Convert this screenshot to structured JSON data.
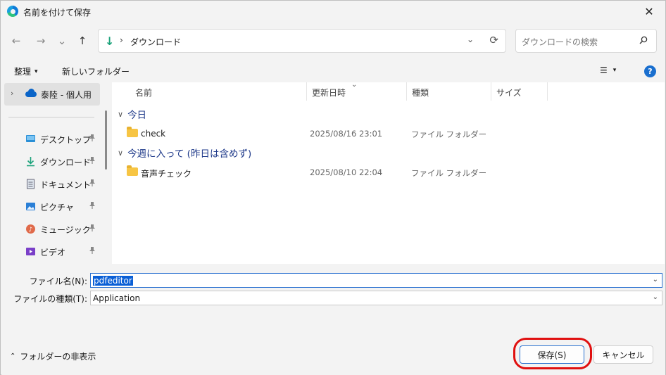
{
  "window": {
    "title": "名前を付けて保存",
    "close_glyph": "✕"
  },
  "nav": {
    "back": "←",
    "forward": "→",
    "recent": "⌄",
    "up": "↑",
    "address": {
      "location": "ダウンロード",
      "chevron": "›",
      "dropdown": "⌄",
      "refresh": "⟳"
    },
    "search": {
      "placeholder": "ダウンロードの検索"
    }
  },
  "toolbar": {
    "organize": "整理",
    "organize_caret": "▾",
    "new_folder": "新しいフォルダー",
    "view_glyph": "☰",
    "view_caret": "▾",
    "help": "?"
  },
  "sidebar": {
    "onedrive": {
      "label": "泰陸 - 個人用",
      "chevron": "›"
    },
    "items": [
      {
        "label": "デスクトップ",
        "icon": "desktop-icon"
      },
      {
        "label": "ダウンロード",
        "icon": "download-icon"
      },
      {
        "label": "ドキュメント",
        "icon": "document-icon"
      },
      {
        "label": "ピクチャ",
        "icon": "pictures-icon"
      },
      {
        "label": "ミュージック",
        "icon": "music-icon"
      },
      {
        "label": "ビデオ",
        "icon": "video-icon"
      }
    ]
  },
  "content": {
    "columns": [
      "名前",
      "更新日時",
      "種類",
      "サイズ"
    ],
    "sort_glyph": "⌄",
    "groups": [
      {
        "label": "今日",
        "chevron": "∨",
        "files": [
          {
            "name": "check",
            "date": "2025/08/16 23:01",
            "type": "ファイル フォルダー"
          }
        ]
      },
      {
        "label": "今週に入って (昨日は含めず)",
        "chevron": "∨",
        "files": [
          {
            "name": "音声チェック",
            "date": "2025/08/10 22:04",
            "type": "ファイル フォルダー"
          }
        ]
      }
    ]
  },
  "form": {
    "filename_label": "ファイル名(N):",
    "filename_value": "pdfeditor",
    "filetype_label": "ファイルの種類(T):",
    "filetype_value": "Application",
    "caret": "⌄"
  },
  "footer": {
    "hide_folders": "フォルダーの非表示",
    "hide_caret": "⌃",
    "save": "保存(S)",
    "cancel": "キャンセル"
  },
  "colors": {
    "accent": "#2a71d0",
    "highlight": "#e01010",
    "group_heading": "#1f3a8a",
    "folder": "#f7c544"
  }
}
